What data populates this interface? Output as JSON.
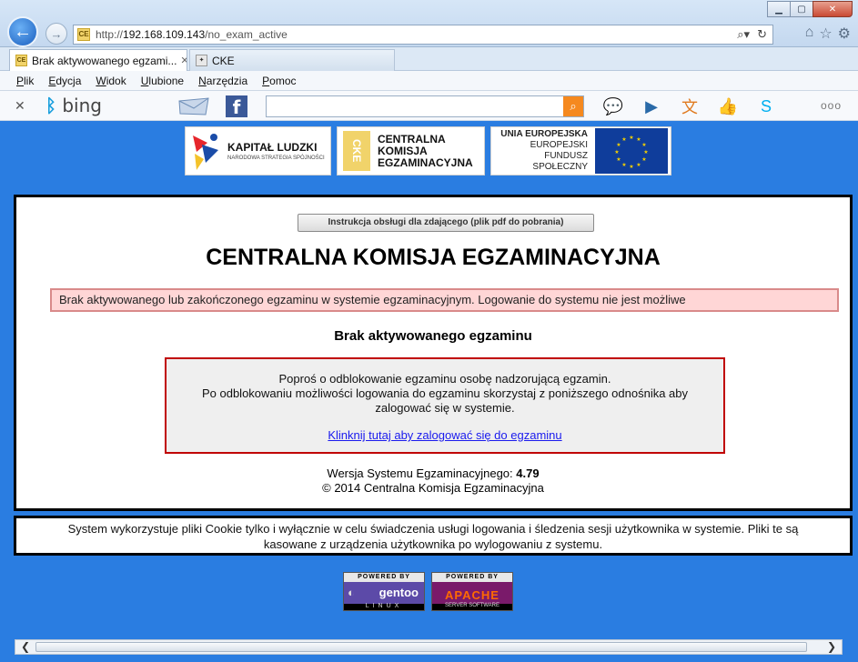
{
  "browser": {
    "address": {
      "prefix": "http://",
      "host": "192.168.109.143",
      "path": "/no_exam_active"
    },
    "tabs": [
      {
        "label": "Brak aktywowanego egzami...",
        "close": "✕"
      },
      {
        "label": "CKE"
      }
    ],
    "menu": [
      {
        "label": "Plik",
        "underline": "P",
        "rest": "lik"
      },
      {
        "label": "Edycja",
        "underline": "E",
        "rest": "dycja"
      },
      {
        "label": "Widok",
        "underline": "W",
        "rest": "idok"
      },
      {
        "label": "Ulubione",
        "underline": "U",
        "rest": "lubione"
      },
      {
        "label": "Narzędzia",
        "underline": "N",
        "rest": "arzędzia"
      },
      {
        "label": "Pomoc",
        "underline": "P",
        "rest": "omoc"
      }
    ],
    "bing": {
      "close": "✕",
      "logo": "bing",
      "more": "ooo"
    }
  },
  "logos": {
    "kapital": {
      "line1": "KAPITAŁ LUDZKI",
      "line2": "NARODOWA STRATEGIA SPÓJNOŚCI"
    },
    "cke": {
      "mark": "CKE",
      "line1": "CENTRALNA",
      "line2": "KOMISJA",
      "line3": "EGZAMINACYJNA"
    },
    "ue": {
      "line1": "UNIA EUROPEJSKA",
      "line2": "EUROPEJSKI",
      "line3": "FUNDUSZ SPOŁECZNY"
    }
  },
  "page": {
    "instruction_button": "Instrukcja obsługi dla zdającego (plik pdf do pobrania)",
    "title": "CENTRALNA KOMISJA EGZAMINACYJNA",
    "alert": "Brak aktywowanego lub zakończonego egzaminu w systemie egzaminacyjnym. Logowanie do systemu nie jest możliwe",
    "subtitle": "Brak aktywowanego egzaminu",
    "info_line1": "Poproś o odblokowanie egzaminu osobę nadzorującą egzamin.",
    "info_line2": "Po odblokowaniu możliwości logowania do egzaminu skorzystaj z poniższego odnośnika aby zalogować się w systemie.",
    "login_link": "Klinknij tutaj aby zalogować się do egzaminu",
    "version_label": "Wersja Systemu Egzaminacyjnego:",
    "version_value": "4.79",
    "copyright": "© 2014 Centralna Komisja Egzaminacyjna",
    "cookie_notice": "System wykorzystuje pliki Cookie tylko i wyłącznie w celu świadczenia usługi logowania i śledzenia sesji użytkownika w systemie. Pliki te są kasowane z urządzenia użytkownika po wylogowaniu z systemu."
  },
  "badges": {
    "gentoo": {
      "top": "POWERED BY",
      "name": "gentoo",
      "bottom": "LINUX"
    },
    "apache": {
      "top": "POWERED BY",
      "name": "APACHE",
      "bottom": "SERVER SOFTWARE"
    }
  },
  "colors": {
    "page_bg": "#2a7de1",
    "alert_bg": "#ffd6d6",
    "info_border": "#c00000",
    "link": "#1a1aee"
  }
}
